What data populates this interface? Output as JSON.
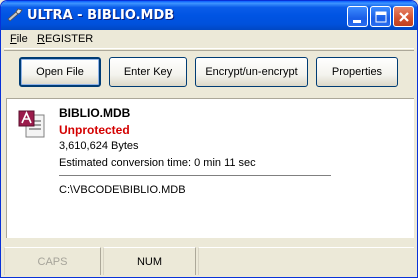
{
  "window": {
    "title": "ULTRA - BIBLIO.MDB",
    "icon": "app-wrench-icon"
  },
  "menu": {
    "file": {
      "accel": "F",
      "rest": "ile"
    },
    "register": {
      "accel": "R",
      "rest": "EGISTER"
    }
  },
  "toolbar": {
    "open_label": "Open File",
    "enter_key_label": "Enter Key",
    "encrypt_label": "Encrypt/un-encrypt",
    "properties_label": "Properties"
  },
  "file_info": {
    "icon": "access-database-icon",
    "name": "BIBLIO.MDB",
    "status": "Unprotected",
    "status_color": "#d40000",
    "size": "3,610,624 Bytes",
    "conversion_time": "Estimated conversion time: 0 min 11 sec",
    "path": "C:\\VBCODE\\BIBLIO.MDB"
  },
  "statusbar": {
    "caps": "CAPS",
    "num": "NUM",
    "caps_active": false,
    "num_active": true
  },
  "colors": {
    "titlebar": "#0054e3",
    "window_bg": "#ece9d8"
  }
}
